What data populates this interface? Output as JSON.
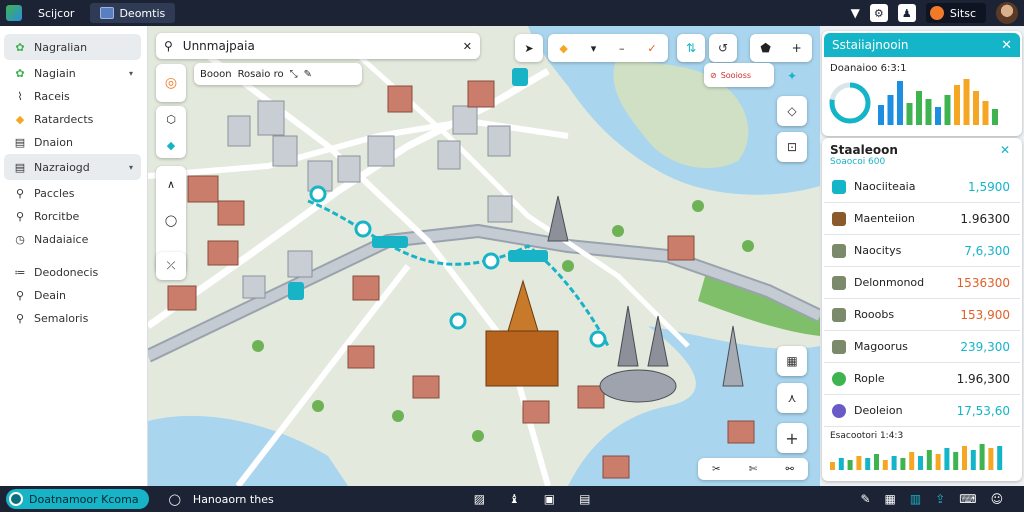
{
  "topbar": {
    "tab1_label": "Scijcor",
    "tab2_label": "Deomtis",
    "pill_label": "Sitsc"
  },
  "sidebar": {
    "items": [
      {
        "label": "Nagralian",
        "icon": "leaf-icon"
      },
      {
        "label": "Nagiain",
        "icon": "leaf-icon"
      },
      {
        "label": "Raceis",
        "icon": "route-icon"
      },
      {
        "label": "Ratardects",
        "icon": "palette-icon"
      },
      {
        "label": "Dnaion",
        "icon": "document-icon"
      },
      {
        "label": "Nazraiogd",
        "icon": "document-icon"
      },
      {
        "label": "Paccles",
        "icon": "pin-icon"
      },
      {
        "label": "Rorcitbe",
        "icon": "pin-icon"
      },
      {
        "label": "Nadaiaice",
        "icon": "gauge-icon"
      },
      {
        "label": "Deodonecis",
        "icon": "list-icon"
      },
      {
        "label": "Deain",
        "icon": "pin-icon"
      },
      {
        "label": "Semaloris",
        "icon": "pin-icon"
      }
    ]
  },
  "search": {
    "value": "Unnmajpaia"
  },
  "map_toolbar": {
    "chip1": "Booon",
    "chip2": "Rosaio ro"
  },
  "map_labels": {
    "badge": "Sooioss"
  },
  "stats_card": {
    "title": "Sstaiiajnooin",
    "subtitle": "Doanaioo 6:3:1",
    "colors": {
      "accent": "#14b5c8",
      "blue": "#1e8fe0",
      "green": "#3fb34f",
      "orange": "#f5a623"
    }
  },
  "list_card": {
    "title": "Staaleoon",
    "subtitle": "Soaocoi 600",
    "rows": [
      {
        "label": "Naociiteaia",
        "value": "1,5900",
        "color": "#14b5c8",
        "icon": "teal-square-icon"
      },
      {
        "label": "Maenteiion",
        "value": "1.96300",
        "color": "#222222",
        "icon": "brown-square-icon"
      },
      {
        "label": "Naocitys",
        "value": "7,6,300",
        "color": "#14b5c8",
        "icon": "map-thumb-icon"
      },
      {
        "label": "Delonmonod",
        "value": "1536300",
        "color": "#e0602a",
        "icon": "map-thumb-icon"
      },
      {
        "label": "Rooobs",
        "value": "153,900",
        "color": "#e0602a",
        "icon": "map-thumb-icon"
      },
      {
        "label": "Magoorus",
        "value": "239,300",
        "color": "#14b5c8",
        "icon": "map-thumb-icon"
      },
      {
        "label": "Rople",
        "value": "1.96,300",
        "color": "#222222",
        "icon": "green-leaf-icon"
      },
      {
        "label": "Deoleion",
        "value": "17,53,60",
        "color": "#14b5c8",
        "icon": "purple-circle-icon"
      }
    ]
  },
  "bottom_chart": {
    "label": "Esacootori 1:4:3"
  },
  "bottombar": {
    "button_label": "Doatnamoor Kcoma",
    "status_label": "Hanoaorn thes"
  }
}
